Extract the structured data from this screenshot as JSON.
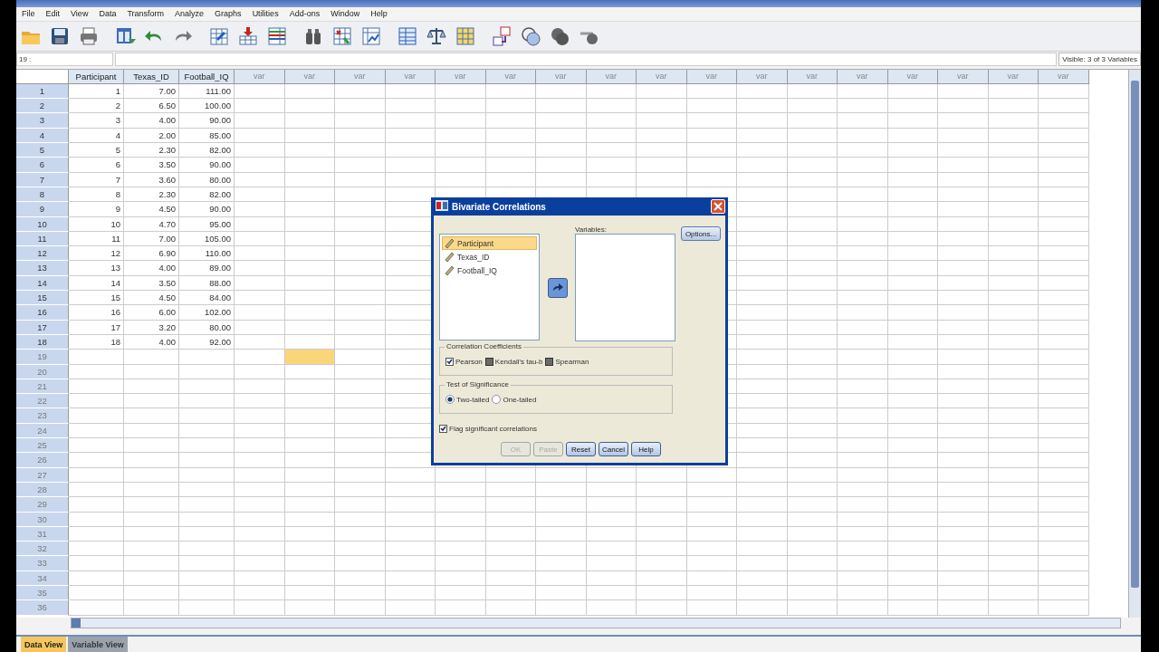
{
  "menu": [
    "File",
    "Edit",
    "View",
    "Data",
    "Transform",
    "Analyze",
    "Graphs",
    "Utilities",
    "Add-ons",
    "Window",
    "Help"
  ],
  "cell_ref": "19 :",
  "visible_info": "Visible: 3 of 3 Variables",
  "columns": [
    {
      "label": "Participant",
      "selected": false
    },
    {
      "label": "Texas_ID",
      "selected": false
    },
    {
      "label": "Football_IQ",
      "selected": false
    },
    {
      "label": "var",
      "selected": false
    },
    {
      "label": "var",
      "selected": true
    },
    {
      "label": "var",
      "selected": false
    },
    {
      "label": "var",
      "selected": false
    },
    {
      "label": "var",
      "selected": false
    },
    {
      "label": "var",
      "selected": false
    },
    {
      "label": "var",
      "selected": false
    },
    {
      "label": "var",
      "selected": false
    },
    {
      "label": "var",
      "selected": false
    },
    {
      "label": "var",
      "selected": false
    },
    {
      "label": "var",
      "selected": false
    },
    {
      "label": "var",
      "selected": false
    },
    {
      "label": "var",
      "selected": false
    },
    {
      "label": "var",
      "selected": false
    },
    {
      "label": "var",
      "selected": false
    },
    {
      "label": "var",
      "selected": false
    },
    {
      "label": "var",
      "selected": false
    }
  ],
  "rows": [
    {
      "number": "1",
      "selected": false,
      "cells": [
        "1",
        "7.00",
        "111.00"
      ]
    },
    {
      "number": "2",
      "selected": false,
      "cells": [
        "2",
        "6.50",
        "100.00"
      ]
    },
    {
      "number": "3",
      "selected": false,
      "cells": [
        "3",
        "4.00",
        "90.00"
      ]
    },
    {
      "number": "4",
      "selected": false,
      "cells": [
        "4",
        "2.00",
        "85.00"
      ]
    },
    {
      "number": "5",
      "selected": false,
      "cells": [
        "5",
        "2.30",
        "82.00"
      ]
    },
    {
      "number": "6",
      "selected": false,
      "cells": [
        "6",
        "3.50",
        "90.00"
      ]
    },
    {
      "number": "7",
      "selected": false,
      "cells": [
        "7",
        "3.60",
        "80.00"
      ]
    },
    {
      "number": "8",
      "selected": false,
      "cells": [
        "8",
        "2.30",
        "82.00"
      ]
    },
    {
      "number": "9",
      "selected": false,
      "cells": [
        "9",
        "4.50",
        "90.00"
      ]
    },
    {
      "number": "10",
      "selected": false,
      "cells": [
        "10",
        "4.70",
        "95.00"
      ]
    },
    {
      "number": "11",
      "selected": false,
      "cells": [
        "11",
        "7.00",
        "105.00"
      ]
    },
    {
      "number": "12",
      "selected": false,
      "cells": [
        "12",
        "6.90",
        "110.00"
      ]
    },
    {
      "number": "13",
      "selected": false,
      "cells": [
        "13",
        "4.00",
        "89.00"
      ]
    },
    {
      "number": "14",
      "selected": false,
      "cells": [
        "14",
        "3.50",
        "88.00"
      ]
    },
    {
      "number": "15",
      "selected": false,
      "cells": [
        "15",
        "4.50",
        "84.00"
      ]
    },
    {
      "number": "16",
      "selected": false,
      "cells": [
        "16",
        "6.00",
        "102.00"
      ]
    },
    {
      "number": "17",
      "selected": false,
      "cells": [
        "17",
        "3.20",
        "80.00"
      ]
    },
    {
      "number": "18",
      "selected": false,
      "cells": [
        "18",
        "4.00",
        "92.00"
      ]
    },
    {
      "number": "19",
      "selected": true
    },
    {
      "number": "20",
      "selected": false
    },
    {
      "number": "21",
      "selected": false
    },
    {
      "number": "22",
      "selected": false
    },
    {
      "number": "23",
      "selected": false
    },
    {
      "number": "24",
      "selected": false
    },
    {
      "number": "25",
      "selected": false
    },
    {
      "number": "26",
      "selected": false
    },
    {
      "number": "27",
      "selected": false
    },
    {
      "number": "28",
      "selected": false
    },
    {
      "number": "29",
      "selected": false
    },
    {
      "number": "30",
      "selected": false
    },
    {
      "number": "31",
      "selected": false
    },
    {
      "number": "32",
      "selected": false
    },
    {
      "number": "33",
      "selected": false
    },
    {
      "number": "34",
      "selected": false
    },
    {
      "number": "35",
      "selected": false
    },
    {
      "number": "36",
      "selected": false
    }
  ],
  "tabs": [
    {
      "label": "Data View",
      "selected": true
    },
    {
      "label": "Variable View",
      "selected": false
    }
  ],
  "dialog": {
    "title": "Bivariate Correlations",
    "source_variables": [
      {
        "label": "Participant",
        "selected": true
      },
      {
        "label": "Texas_ID",
        "selected": false
      },
      {
        "label": "Football_IQ",
        "selected": false
      }
    ],
    "variables_label": "Variables:",
    "options_button": "Options...",
    "coefficients": {
      "title": "Correlation Coefficients",
      "items": [
        {
          "label": "Pearson",
          "checked": true
        },
        {
          "label": "Kendall's tau-b",
          "checked": false
        },
        {
          "label": "Spearman",
          "checked": false
        }
      ]
    },
    "significance": {
      "title": "Test of Significance",
      "items": [
        {
          "label": "Two-tailed",
          "selected": true
        },
        {
          "label": "One-tailed",
          "selected": false
        }
      ]
    },
    "flag": {
      "label": "Flag significant correlations",
      "checked": true
    },
    "buttons": [
      {
        "label": "OK",
        "disabled": true
      },
      {
        "label": "Paste",
        "disabled": true
      },
      {
        "label": "Reset",
        "disabled": false
      },
      {
        "label": "Cancel",
        "disabled": false
      },
      {
        "label": "Help",
        "disabled": false
      }
    ]
  }
}
